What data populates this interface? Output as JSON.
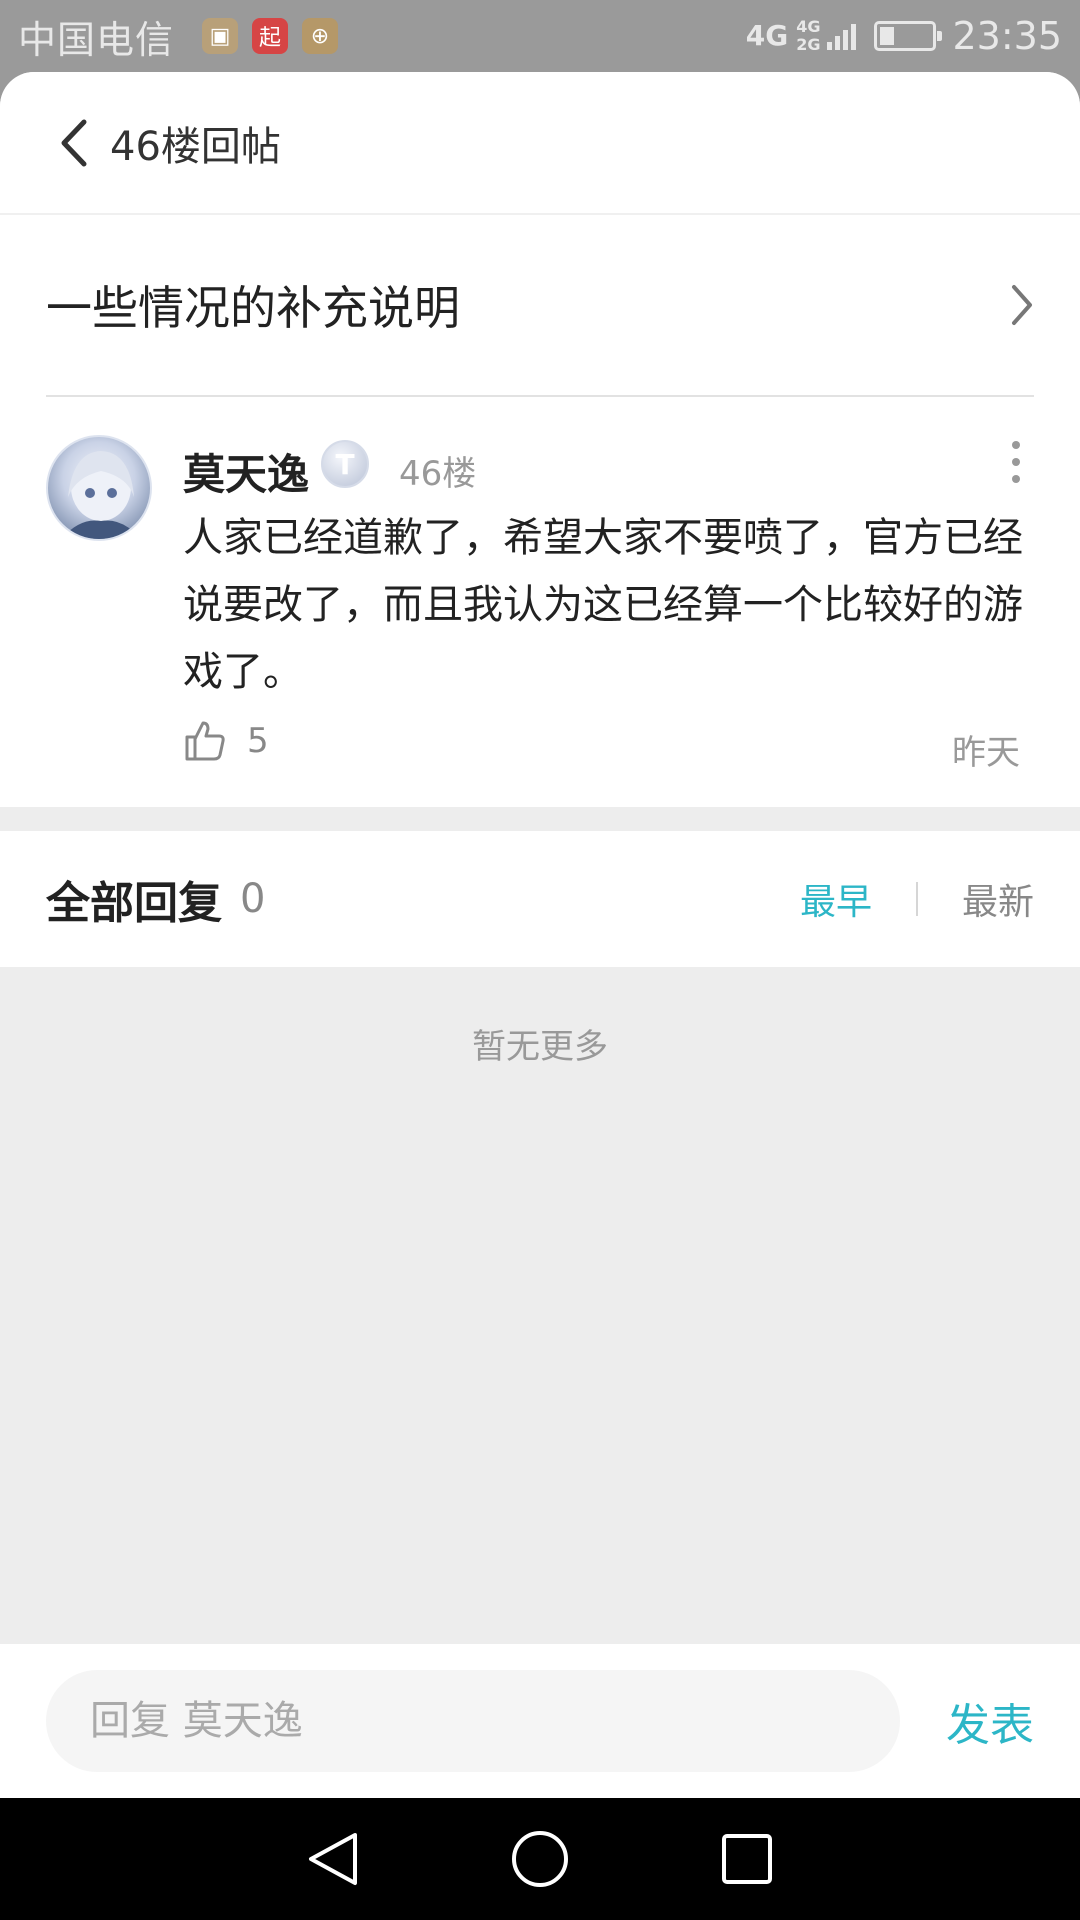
{
  "status_bar": {
    "carrier": "中国电信",
    "notif_icons": [
      "gallery-icon",
      "qidian-icon",
      "app-icon"
    ],
    "notif_glyphs": [
      "▣",
      "起",
      "⊕"
    ],
    "network": "4G",
    "network_secondary": [
      "4G",
      "2G"
    ],
    "time": "23:35"
  },
  "header": {
    "title": "46楼回帖"
  },
  "topic": {
    "title": "一些情况的补充说明"
  },
  "post": {
    "author": "莫天逸",
    "badge": "T",
    "floor": "46楼",
    "content": "人家已经道歉了，希望大家不要喷了，官方已经说要改了，而且我认为这已经算一个比较好的游戏了。",
    "likes": "5",
    "time": "昨天"
  },
  "replies": {
    "title": "全部回复",
    "count": "0",
    "sort_earliest": "最早",
    "sort_newest": "最新",
    "empty_text": "暂无更多"
  },
  "input_bar": {
    "placeholder": "回复 莫天逸",
    "submit_label": "发表"
  },
  "colors": {
    "accent": "#2cb6c7",
    "status_bar": "#9a9a9a",
    "background": "#ededed"
  }
}
